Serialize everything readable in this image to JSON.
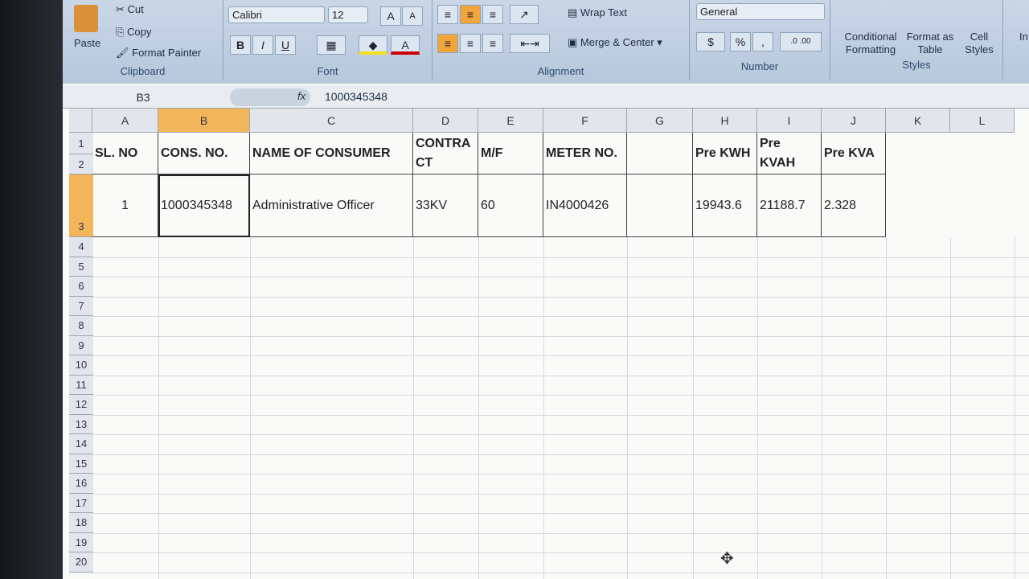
{
  "ribbon": {
    "clipboard": {
      "paste": "Paste",
      "cut": "Cut",
      "copy": "Copy",
      "format_painter": "Format Painter",
      "label": "Clipboard"
    },
    "font": {
      "name": "Calibri",
      "size": "12",
      "bold": "B",
      "italic": "I",
      "underline": "U",
      "label": "Font"
    },
    "alignment": {
      "wrap_text": "Wrap Text",
      "merge_center": "Merge & Center",
      "label": "Alignment"
    },
    "number": {
      "format": "General",
      "percent": "%",
      "comma": ",",
      "label": "Number"
    },
    "styles": {
      "conditional": "Conditional Formatting",
      "format_table": "Format as Table",
      "cell_styles": "Cell Styles",
      "label": "Styles"
    },
    "insert": "In"
  },
  "formula_bar": {
    "name_box": "B3",
    "fx": "fx",
    "value": "1000345348"
  },
  "columns": [
    "A",
    "B",
    "C",
    "D",
    "E",
    "F",
    "G",
    "H",
    "I",
    "J",
    "K",
    "L"
  ],
  "rows": [
    "1",
    "2",
    "3",
    "4",
    "5",
    "6",
    "7",
    "8",
    "9",
    "10",
    "11",
    "12",
    "13",
    "14",
    "15",
    "16",
    "17",
    "18",
    "19",
    "20"
  ],
  "headers": [
    "SL. NO",
    "CONS. NO.",
    "NAME OF CONSUMER",
    "CONTRA CT",
    "M/F",
    "METER NO.",
    "",
    "Pre KWH",
    "Pre KVAH",
    "Pre KVA"
  ],
  "data_row": [
    "1",
    "1000345348",
    "Administrative Officer",
    "33KV",
    "60",
    "IN4000426",
    "",
    "19943.6",
    "21188.7",
    "2.328"
  ]
}
